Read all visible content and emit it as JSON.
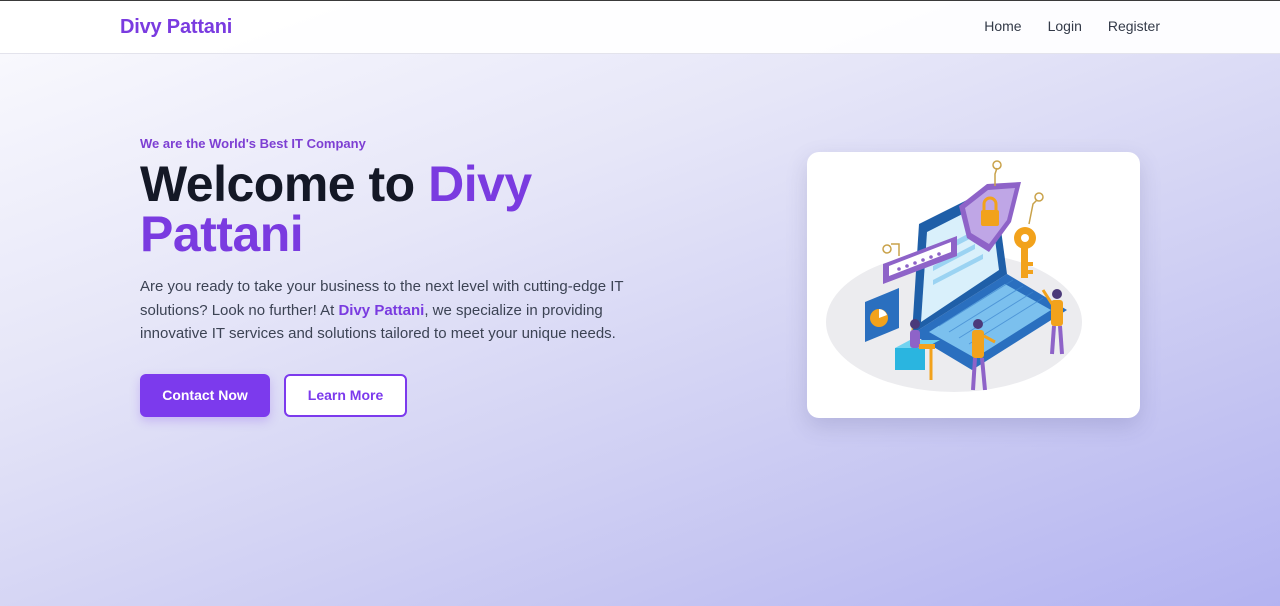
{
  "header": {
    "brand": "Divy Pattani",
    "nav": [
      {
        "label": "Home"
      },
      {
        "label": "Login"
      },
      {
        "label": "Register"
      }
    ]
  },
  "hero": {
    "tagline": "We are the World's Best IT Company",
    "headline_prefix": "Welcome to ",
    "headline_accent": "Divy Pattani",
    "description_before": "Are you ready to take your business to the next level with cutting-edge IT solutions? Look no further! At ",
    "description_accent": "Divy Pattani",
    "description_after": ", we specialize in providing innovative IT services and solutions tailored to meet your unique needs.",
    "primary_button": "Contact Now",
    "secondary_button": "Learn More",
    "illustration": "it-security-isometric-illustration"
  },
  "colors": {
    "accent": "#7c3aed",
    "text_dark": "#141826",
    "background_end": "#b3b3f1"
  }
}
